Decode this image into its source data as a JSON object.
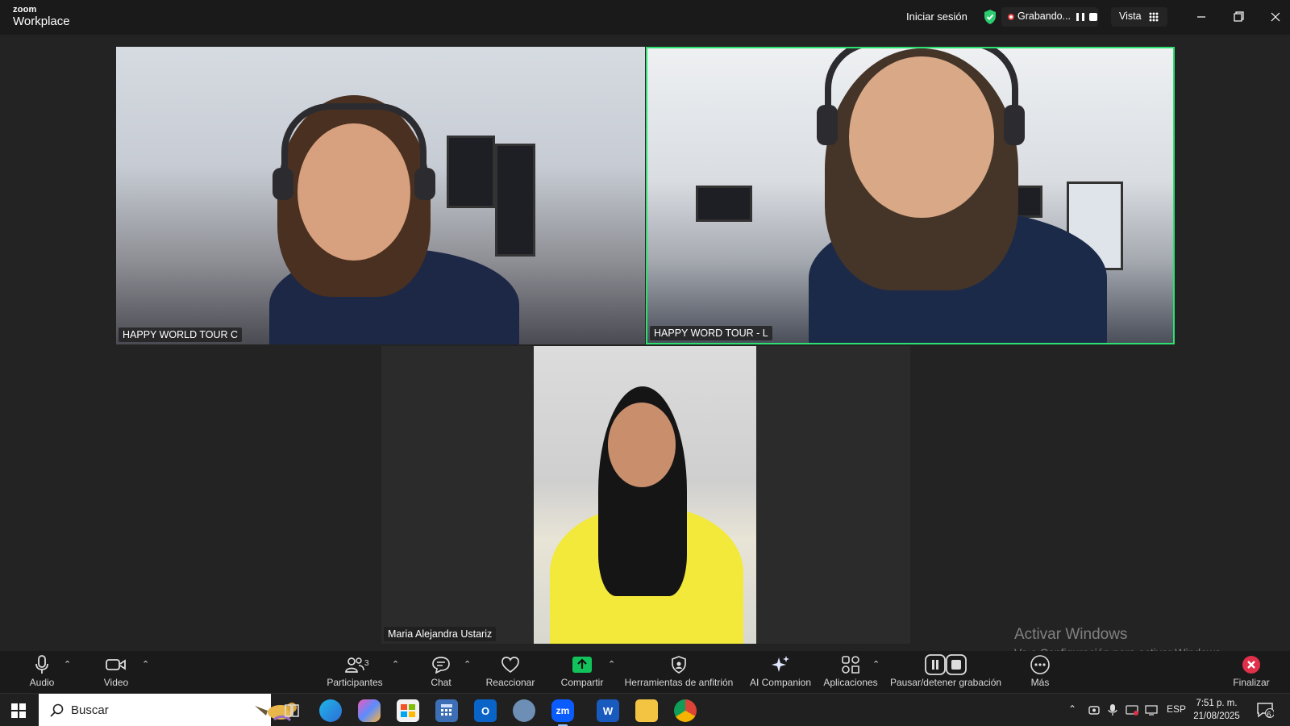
{
  "app": {
    "brand_top": "zoom",
    "brand_bottom": "Workplace"
  },
  "titlebar": {
    "signin": "Iniciar sesión",
    "recording": "Grabando...",
    "view": "Vista"
  },
  "participants": [
    {
      "name": "HAPPY WORLD TOUR C",
      "active_speaker": false
    },
    {
      "name": "HAPPY WORD TOUR - L",
      "active_speaker": true
    },
    {
      "name": "Maria Alejandra Ustariz",
      "active_speaker": false
    }
  ],
  "toolbar": {
    "audio": "Audio",
    "video": "Video",
    "participants": "Participantes",
    "participants_count": "3",
    "chat": "Chat",
    "react": "Reaccionar",
    "share": "Compartir",
    "host_tools": "Herramientas de anfitrión",
    "ai_companion": "AI Companion",
    "apps": "Aplicaciones",
    "pause_recording": "Pausar/detener grabación",
    "more": "Más",
    "end": "Finalizar"
  },
  "watermark": {
    "line1": "Activar Windows",
    "line2": "Ve a Configuración para activar Windows."
  },
  "taskbar": {
    "search_placeholder": "Buscar",
    "language": "ESP",
    "time": "7:51 p. m.",
    "date": "21/08/2025",
    "notifications": "6"
  },
  "colors": {
    "active_speaker_border": "#2ee071",
    "share_green": "#12c35c",
    "end_red": "#e0304a"
  }
}
